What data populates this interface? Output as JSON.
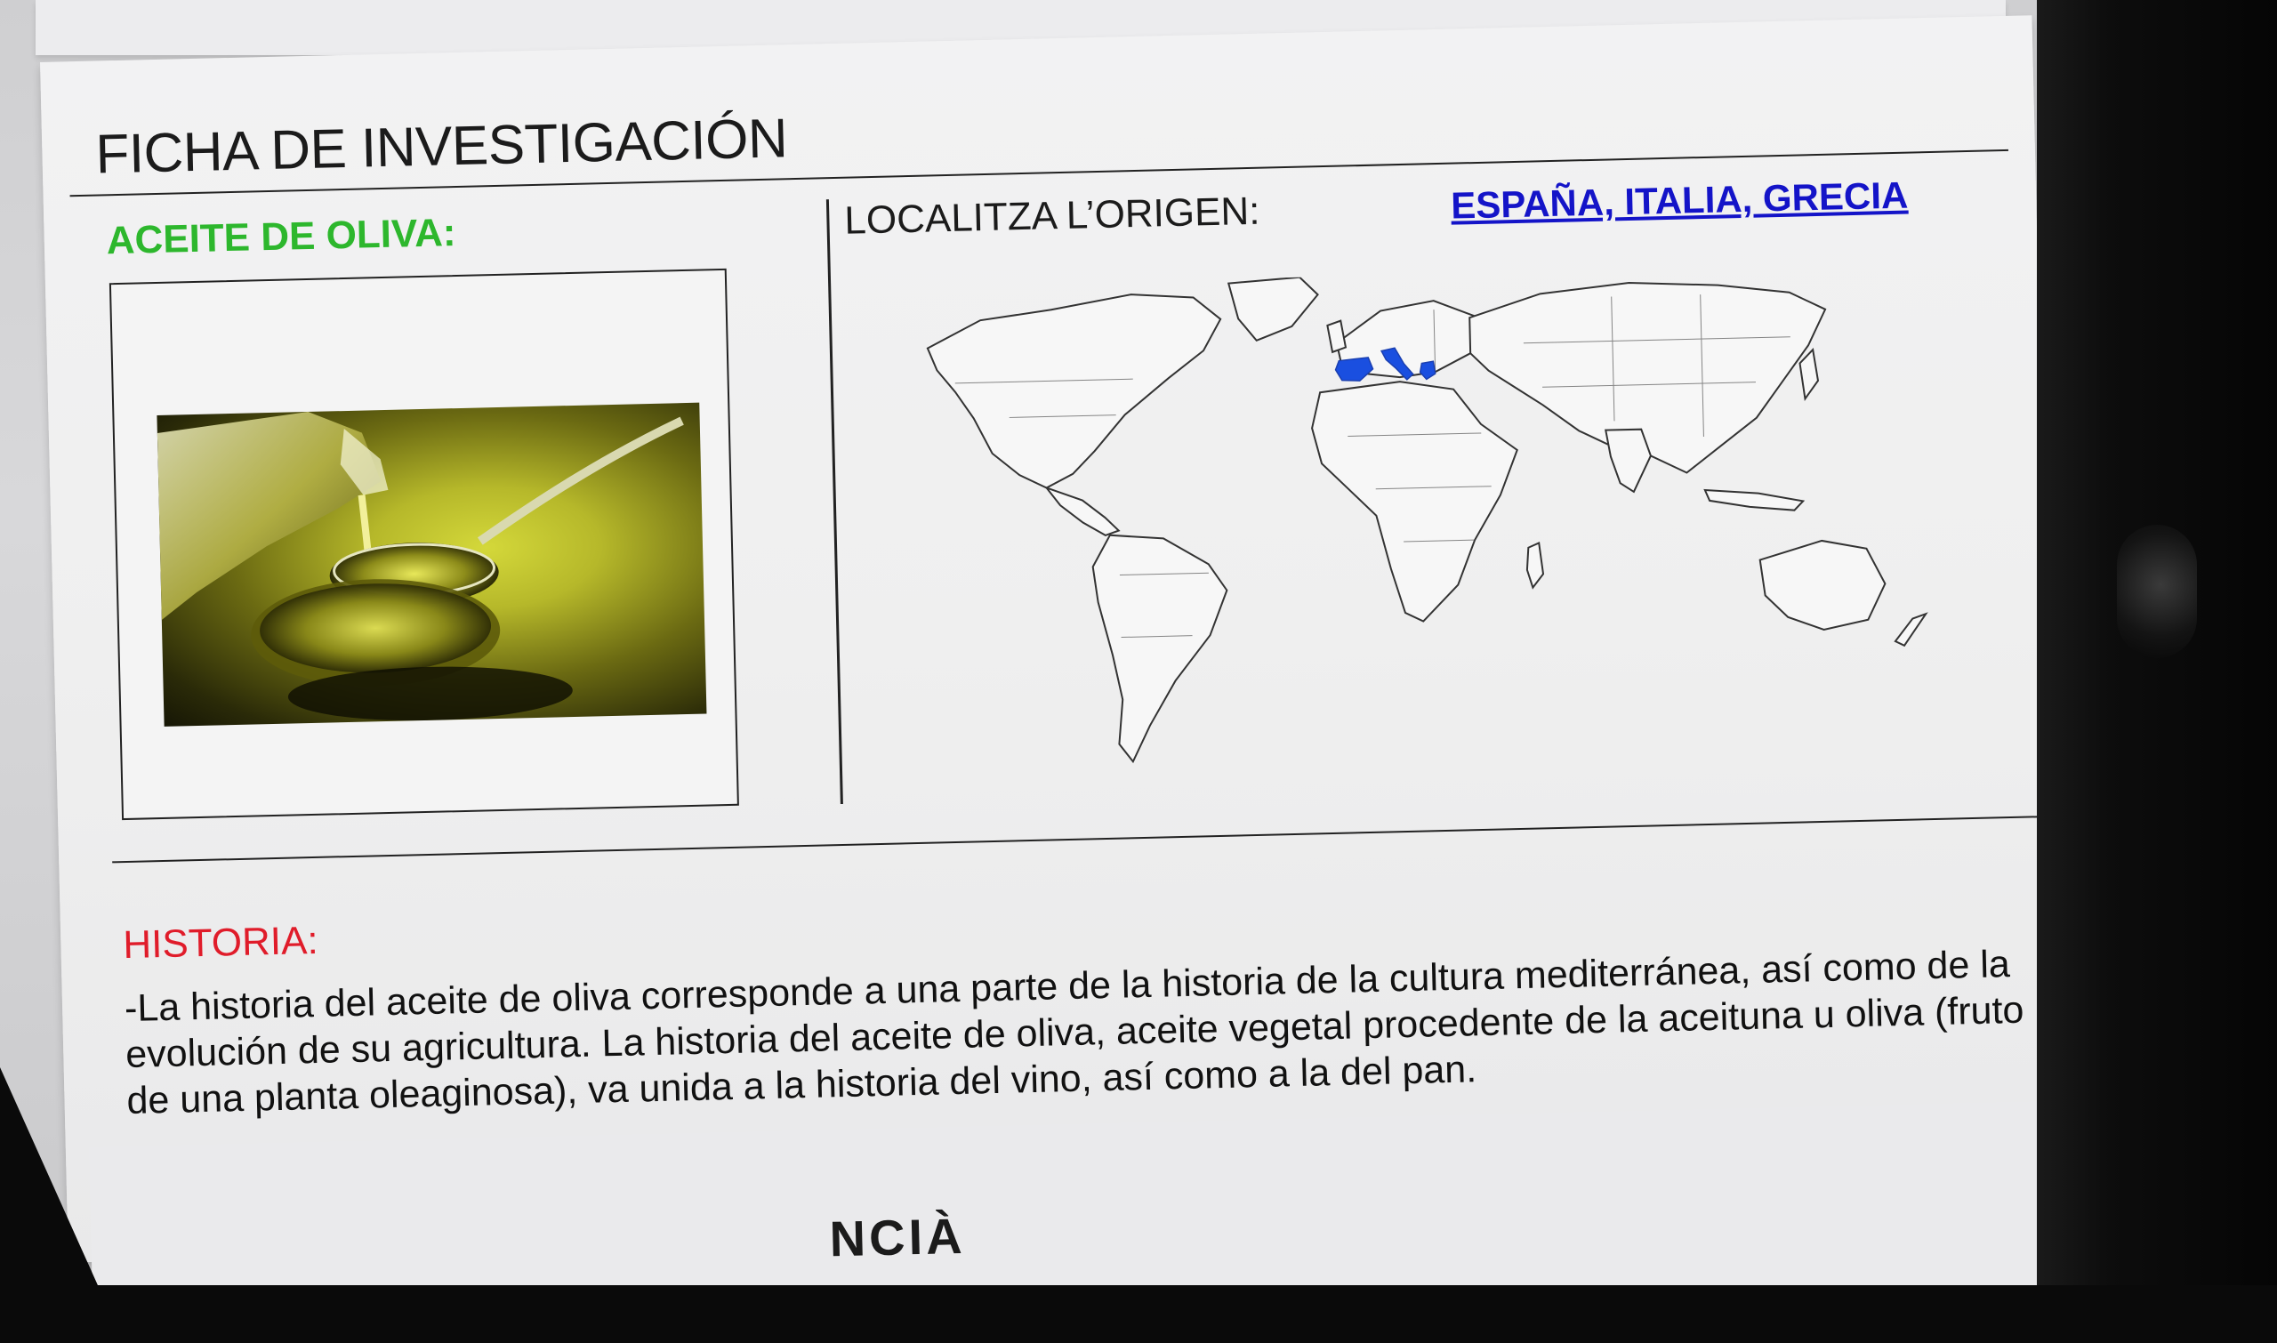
{
  "sheet": {
    "title": "FICHA DE INVESTIGACIÓN",
    "product_label": "ACEITE DE OLIVA:",
    "locate_label": "LOCALITZA L’ORIGEN:",
    "origin_link": "ESPAÑA, ITALIA, GRECIA",
    "history_label": "HISTORIA:",
    "history_text": "-La historia del aceite de oliva corresponde a una parte de la historia de la cultura mediterránea, así como de la evolución de su agricultura. La historia del aceite de oliva, aceite vegetal procedente de la aceituna u oliva (fruto de una planta oleaginosa), va unida a la historia del vino, así como a la del pan.",
    "next_section_fragment": "NCIÀ"
  },
  "map": {
    "highlighted_countries": [
      "España",
      "Italia",
      "Grecia"
    ],
    "highlight_color": "#1a4fe0",
    "outline_color": "#333333"
  },
  "colors": {
    "product_label": "#2db72d",
    "history_label": "#e01c2a",
    "link": "#1414c8"
  }
}
